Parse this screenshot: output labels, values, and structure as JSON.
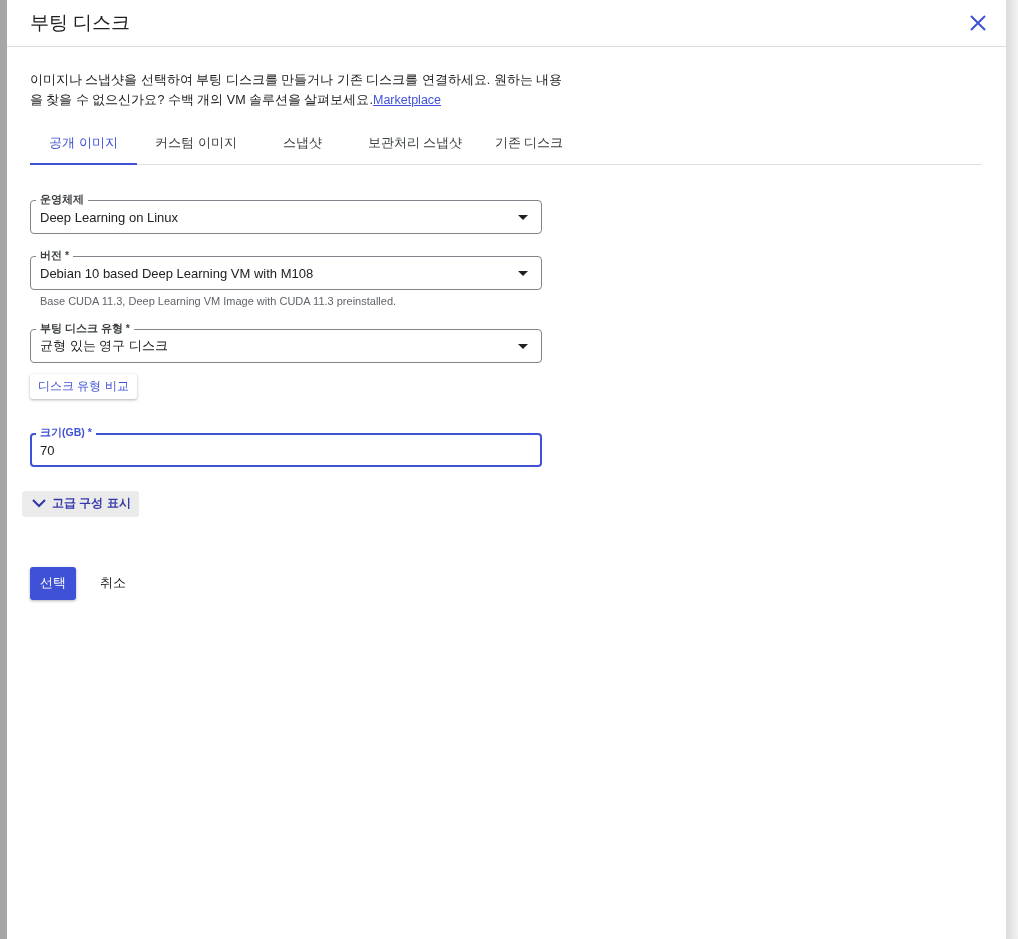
{
  "dialog": {
    "title": "부팅 디스크"
  },
  "intro": {
    "text": "이미지나 스냅샷을 선택하여 부팅 디스크를 만들거나 기존 디스크를 연결하세요. 원하는 내용을 찾을 수 없으신가요? 수백 개의 VM 솔루션을 살펴보세요.",
    "link": "Marketplace"
  },
  "tabs": [
    {
      "label": "공개 이미지",
      "selected": true
    },
    {
      "label": "커스텀 이미지",
      "selected": false
    },
    {
      "label": "스냅샷",
      "selected": false
    },
    {
      "label": "보관처리 스냅샷",
      "selected": false
    },
    {
      "label": "기존 디스크",
      "selected": false
    }
  ],
  "fields": [
    {
      "kind": "select",
      "label": "운영체제",
      "value": "Deep Learning on Linux",
      "focused": false
    },
    {
      "kind": "select",
      "label": "버전 *",
      "value": "Debian 10 based Deep Learning VM with M108",
      "helper": "Base CUDA 11.3, Deep Learning VM Image with CUDA 11.3 preinstalled.",
      "focused": false
    },
    {
      "kind": "select",
      "label": "부팅 디스크 유형 *",
      "value": "균형 있는 영구 디스크",
      "focused": false
    },
    {
      "kind": "button",
      "label": "디스크 유형 비교"
    },
    {
      "kind": "input",
      "label": "크기(GB) *",
      "value": "70",
      "focused": true
    }
  ],
  "advanced": {
    "label": "고급 구성 표시",
    "expanded": false
  },
  "actions": {
    "primary": "선택",
    "secondary": "취소"
  }
}
